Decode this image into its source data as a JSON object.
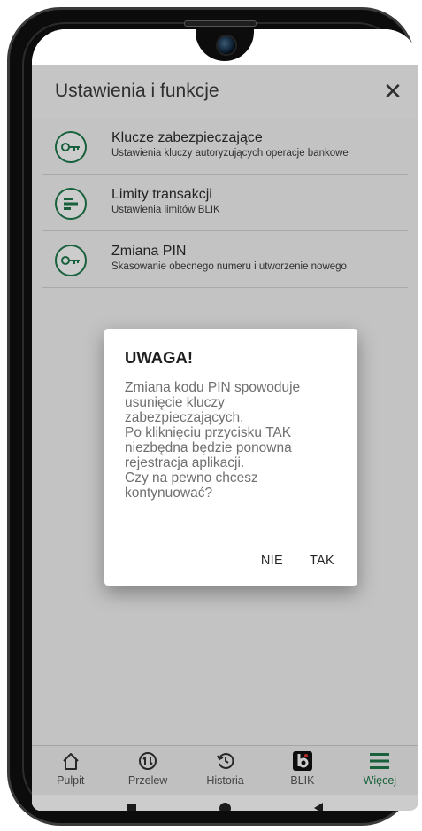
{
  "header": {
    "title": "Ustawienia i funkcje",
    "close_icon": "close-icon"
  },
  "settings": [
    {
      "title": "Klucze zabezpieczające",
      "subtitle": "Ustawienia kluczy autoryzujących operacje bankowe",
      "icon": "key-icon"
    },
    {
      "title": "Limity transakcji",
      "subtitle": "Ustawienia limitów BLIK",
      "icon": "limits-icon"
    },
    {
      "title": "Zmiana PIN",
      "subtitle": "Skasowanie obecnego numeru i utworzenie nowego",
      "icon": "key-icon"
    }
  ],
  "dialog": {
    "title": "UWAGA!",
    "message": "Zmiana kodu PIN spowoduje\nusunięcie kluczy\nzabezpieczających.\nPo kliknięciu przycisku TAK\nniezbędna będzie ponowna\nrejestracja aplikacji.\nCzy na pewno chcesz\nkontynuować?",
    "no_label": "NIE",
    "yes_label": "TAK"
  },
  "bottom_nav": [
    {
      "label": "Pulpit",
      "icon": "home-icon"
    },
    {
      "label": "Przelew",
      "icon": "transfer-icon"
    },
    {
      "label": "Historia",
      "icon": "history-icon"
    },
    {
      "label": "BLIK",
      "icon": "blik-icon"
    },
    {
      "label": "Więcej",
      "icon": "menu-icon",
      "active": true
    }
  ],
  "colors": {
    "accent": "#1f7a4c",
    "scrim": "rgba(0,0,0,0.2)"
  }
}
